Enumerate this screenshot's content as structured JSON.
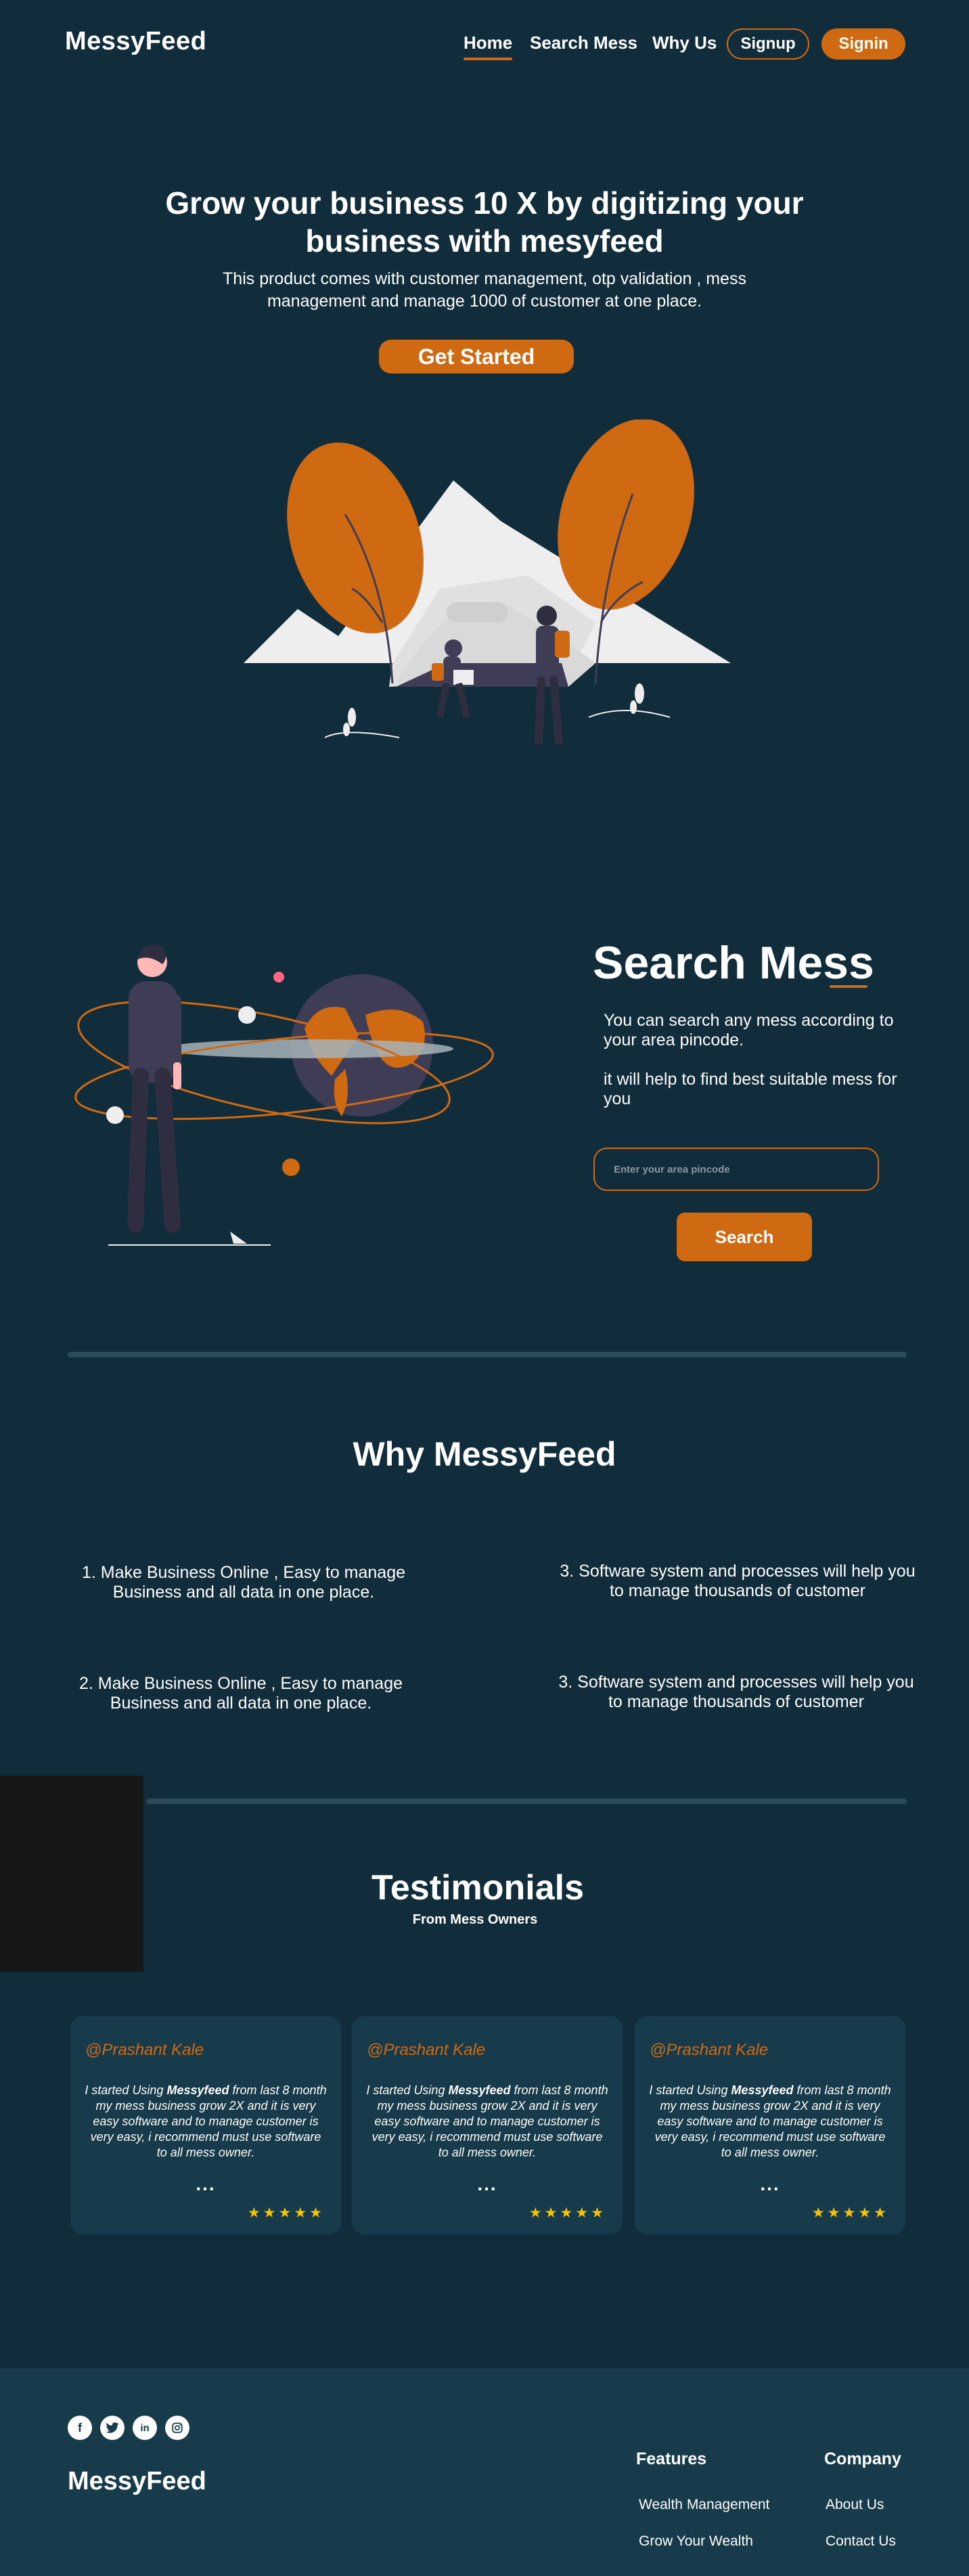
{
  "nav": {
    "logo": "MessyFeed",
    "links": [
      "Home",
      "Search Mess",
      "Why Us"
    ],
    "signup": "Signup",
    "signin": "Signin"
  },
  "hero": {
    "title": "Grow your business 10 X by digitizing your business with mesyfeed",
    "subtitle": "This product comes with customer management, otp validation , mess management and  manage 1000  of customer at one place.",
    "cta": "Get Started"
  },
  "search": {
    "title": "Search Mess",
    "text1": "You can search any mess according to your area pincode.",
    "text2": "it will help to find best suitable mess for you",
    "placeholder": "Enter your area pincode",
    "button": "Search"
  },
  "why": {
    "title": "Why MessyFeed",
    "items": [
      "1. Make Business Online , Easy to manage Business and  all data in one place.",
      "3. Software system and processes will help you to manage thousands of customer",
      "2. Make Business Online , Easy to manage Business and  all data in one place.",
      "3. Software system and processes will help you to manage thousands of customer"
    ]
  },
  "testimonials": {
    "title": "Testimonials",
    "subtitle": "From Mess Owners",
    "cards": [
      {
        "author": "@Prashant Kale",
        "quote_pre": "I started Using ",
        "quote_brand": "Messyfeed",
        "quote_post": "  from last 8 month my mess business grow 2X and it is very easy software and to manage customer is very easy, i recommend must use software to all mess owner.",
        "dots": "...",
        "stars": "★★★★★"
      },
      {
        "author": "@Prashant Kale",
        "quote_pre": "I started Using ",
        "quote_brand": "Messyfeed",
        "quote_post": "  from last 8 month my mess business grow 2X and it is very easy software and to manage customer is very easy, i recommend must use software to all mess owner.",
        "dots": "...",
        "stars": "★★★★★"
      },
      {
        "author": "@Prashant Kale",
        "quote_pre": "I started Using ",
        "quote_brand": "Messyfeed",
        "quote_post": "  from last 8 month my mess business grow 2X and it is very easy software and to manage customer is very easy, i recommend must use software to all mess owner.",
        "dots": "...",
        "stars": "★★★★★"
      }
    ]
  },
  "footer": {
    "logo": "MessyFeed",
    "social": [
      "facebook-icon",
      "twitter-icon",
      "linkedin-icon",
      "instagram-icon"
    ],
    "features_title": "Features",
    "features": [
      "Wealth Management",
      "Grow Your Wealth"
    ],
    "company_title": "Company",
    "company": [
      "About Us",
      "Contact Us"
    ]
  },
  "colors": {
    "background": "#112d3b",
    "accent": "#d06a12",
    "card": "#183b4c",
    "star": "#f4c400"
  }
}
